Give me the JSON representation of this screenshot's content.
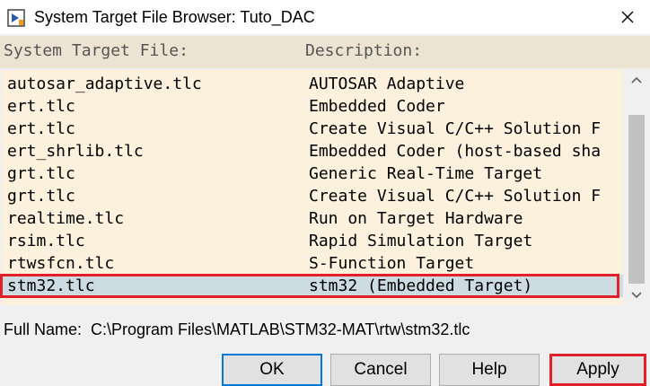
{
  "window": {
    "title": "System Target File Browser: Tuto_DAC",
    "close_glyph": "✕",
    "icon": "simulink-app-icon"
  },
  "columns": {
    "file": "System Target File:",
    "description": "Description:"
  },
  "rows": [
    {
      "file": "autosar_adaptive.tlc",
      "description": "AUTOSAR Adaptive",
      "selected": false
    },
    {
      "file": "ert.tlc",
      "description": "Embedded Coder",
      "selected": false
    },
    {
      "file": "ert.tlc",
      "description": "Create Visual C/C++ Solution F",
      "selected": false
    },
    {
      "file": "ert_shrlib.tlc",
      "description": "Embedded Coder (host-based sha",
      "selected": false
    },
    {
      "file": "grt.tlc",
      "description": "Generic Real-Time Target",
      "selected": false
    },
    {
      "file": "grt.tlc",
      "description": "Create Visual C/C++ Solution F",
      "selected": false
    },
    {
      "file": "realtime.tlc",
      "description": "Run on Target Hardware",
      "selected": false
    },
    {
      "file": "rsim.tlc",
      "description": "Rapid Simulation Target",
      "selected": false
    },
    {
      "file": "rtwsfcn.tlc",
      "description": "S-Function Target",
      "selected": false
    },
    {
      "file": "stm32.tlc",
      "description": "stm32 (Embedded Target)",
      "selected": true
    }
  ],
  "full_name": {
    "label": "Full Name:",
    "value": "C:\\Program Files\\MATLAB\\STM32-MAT\\rtw\\stm32.tlc"
  },
  "scrollbar": {
    "up_glyph": "▲",
    "down_glyph": "▼",
    "thumb_fraction": 0.78
  },
  "buttons": {
    "ok": "OK",
    "cancel": "Cancel",
    "help": "Help",
    "apply": "Apply"
  },
  "colors": {
    "list_background": "#fbf1dc",
    "header_background": "#ece3d3",
    "selected_row": "#cddbe3",
    "highlight_outline": "#e0202a"
  }
}
